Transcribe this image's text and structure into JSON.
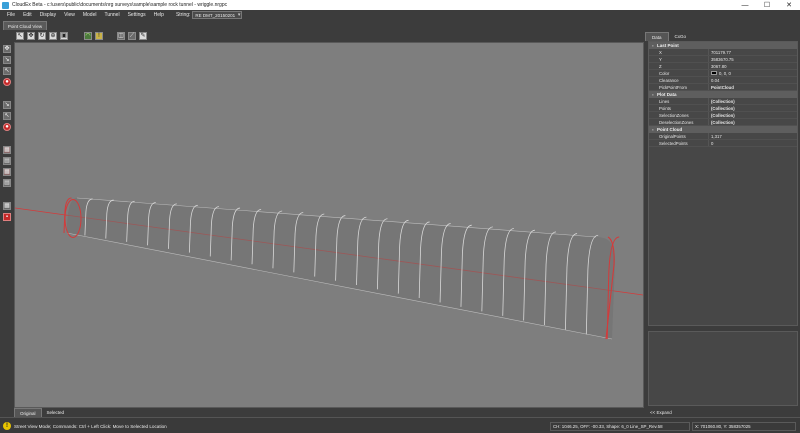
{
  "window": {
    "title": "CloudEx Beta - c:\\users\\public\\documents\\nrg surveys\\sample\\sample rock tunnel - wriggle.nrgpc",
    "minimize": "—",
    "maximize": "☐",
    "close": "✕"
  },
  "menu": {
    "items": [
      "File",
      "Edit",
      "Display",
      "View",
      "Model",
      "Tunnel",
      "Settings",
      "Help"
    ],
    "string_label": "String:",
    "string_value": "RE DMT_20150201"
  },
  "document_tab": "Point Cloud View",
  "toolbar": {
    "icons": [
      "pointer-icon",
      "move-icon",
      "rotate-icon",
      "zoom-icon",
      "fit-icon",
      "tunnel-icon",
      "warning-icon",
      "section-icon",
      "measure-icon",
      "pencil-icon"
    ]
  },
  "left_toolbar": {
    "icons": [
      "pan-icon",
      "pick-icon",
      "select-icon",
      "record-icon",
      "draw-icon",
      "edit-icon",
      "stop-icon",
      "layer-icon",
      "layer2-icon",
      "layer3-icon",
      "layer4-icon",
      "grid-icon",
      "delete-icon"
    ]
  },
  "bottom_tabs": [
    "Original",
    "Selected"
  ],
  "right_panel": {
    "tabs": [
      "Data",
      "CxGo"
    ],
    "categories": [
      {
        "name": "Last Point",
        "rows": [
          {
            "name": "X",
            "value": "701179.77"
          },
          {
            "name": "Y",
            "value": "3583670.75"
          },
          {
            "name": "Z",
            "value": "3067.80"
          },
          {
            "name": "Color",
            "value": "0, 0, 0",
            "swatch": "#000000"
          },
          {
            "name": "Clearance",
            "value": "0.04"
          },
          {
            "name": "PickPointFrom",
            "value": "PointCloud",
            "bold": true
          }
        ]
      },
      {
        "name": "Plot Data",
        "rows": [
          {
            "name": "Lines",
            "value": "(Collection)",
            "bold": true
          },
          {
            "name": "Points",
            "value": "(Collection)",
            "bold": true
          },
          {
            "name": "SelectionZones",
            "value": "(Collection)",
            "bold": true
          },
          {
            "name": "DeselectionZones",
            "value": "(Collection)",
            "bold": true
          }
        ]
      },
      {
        "name": "Point Cloud",
        "rows": [
          {
            "name": "OriginalPoints",
            "value": "1,317"
          },
          {
            "name": "SelectedPoints",
            "value": "0"
          }
        ]
      }
    ],
    "expand_label": "<< Expand"
  },
  "status": {
    "message": "Street View Mode; Commands: Ctrl + Left Click: Move to Selected Location",
    "chainage": "CH: 1046.25,  OFF: -00.33,  Shape: 6_0 Line_SP_Rev.58",
    "coords": "X: 701060.80,  Y: 358357025"
  },
  "colors": {
    "viewport_bg": "#7e7e7e",
    "tunnel_section": "#d8d8d8",
    "tunnel_end": "#d43a3a",
    "axis_line": "#d43a3a"
  }
}
